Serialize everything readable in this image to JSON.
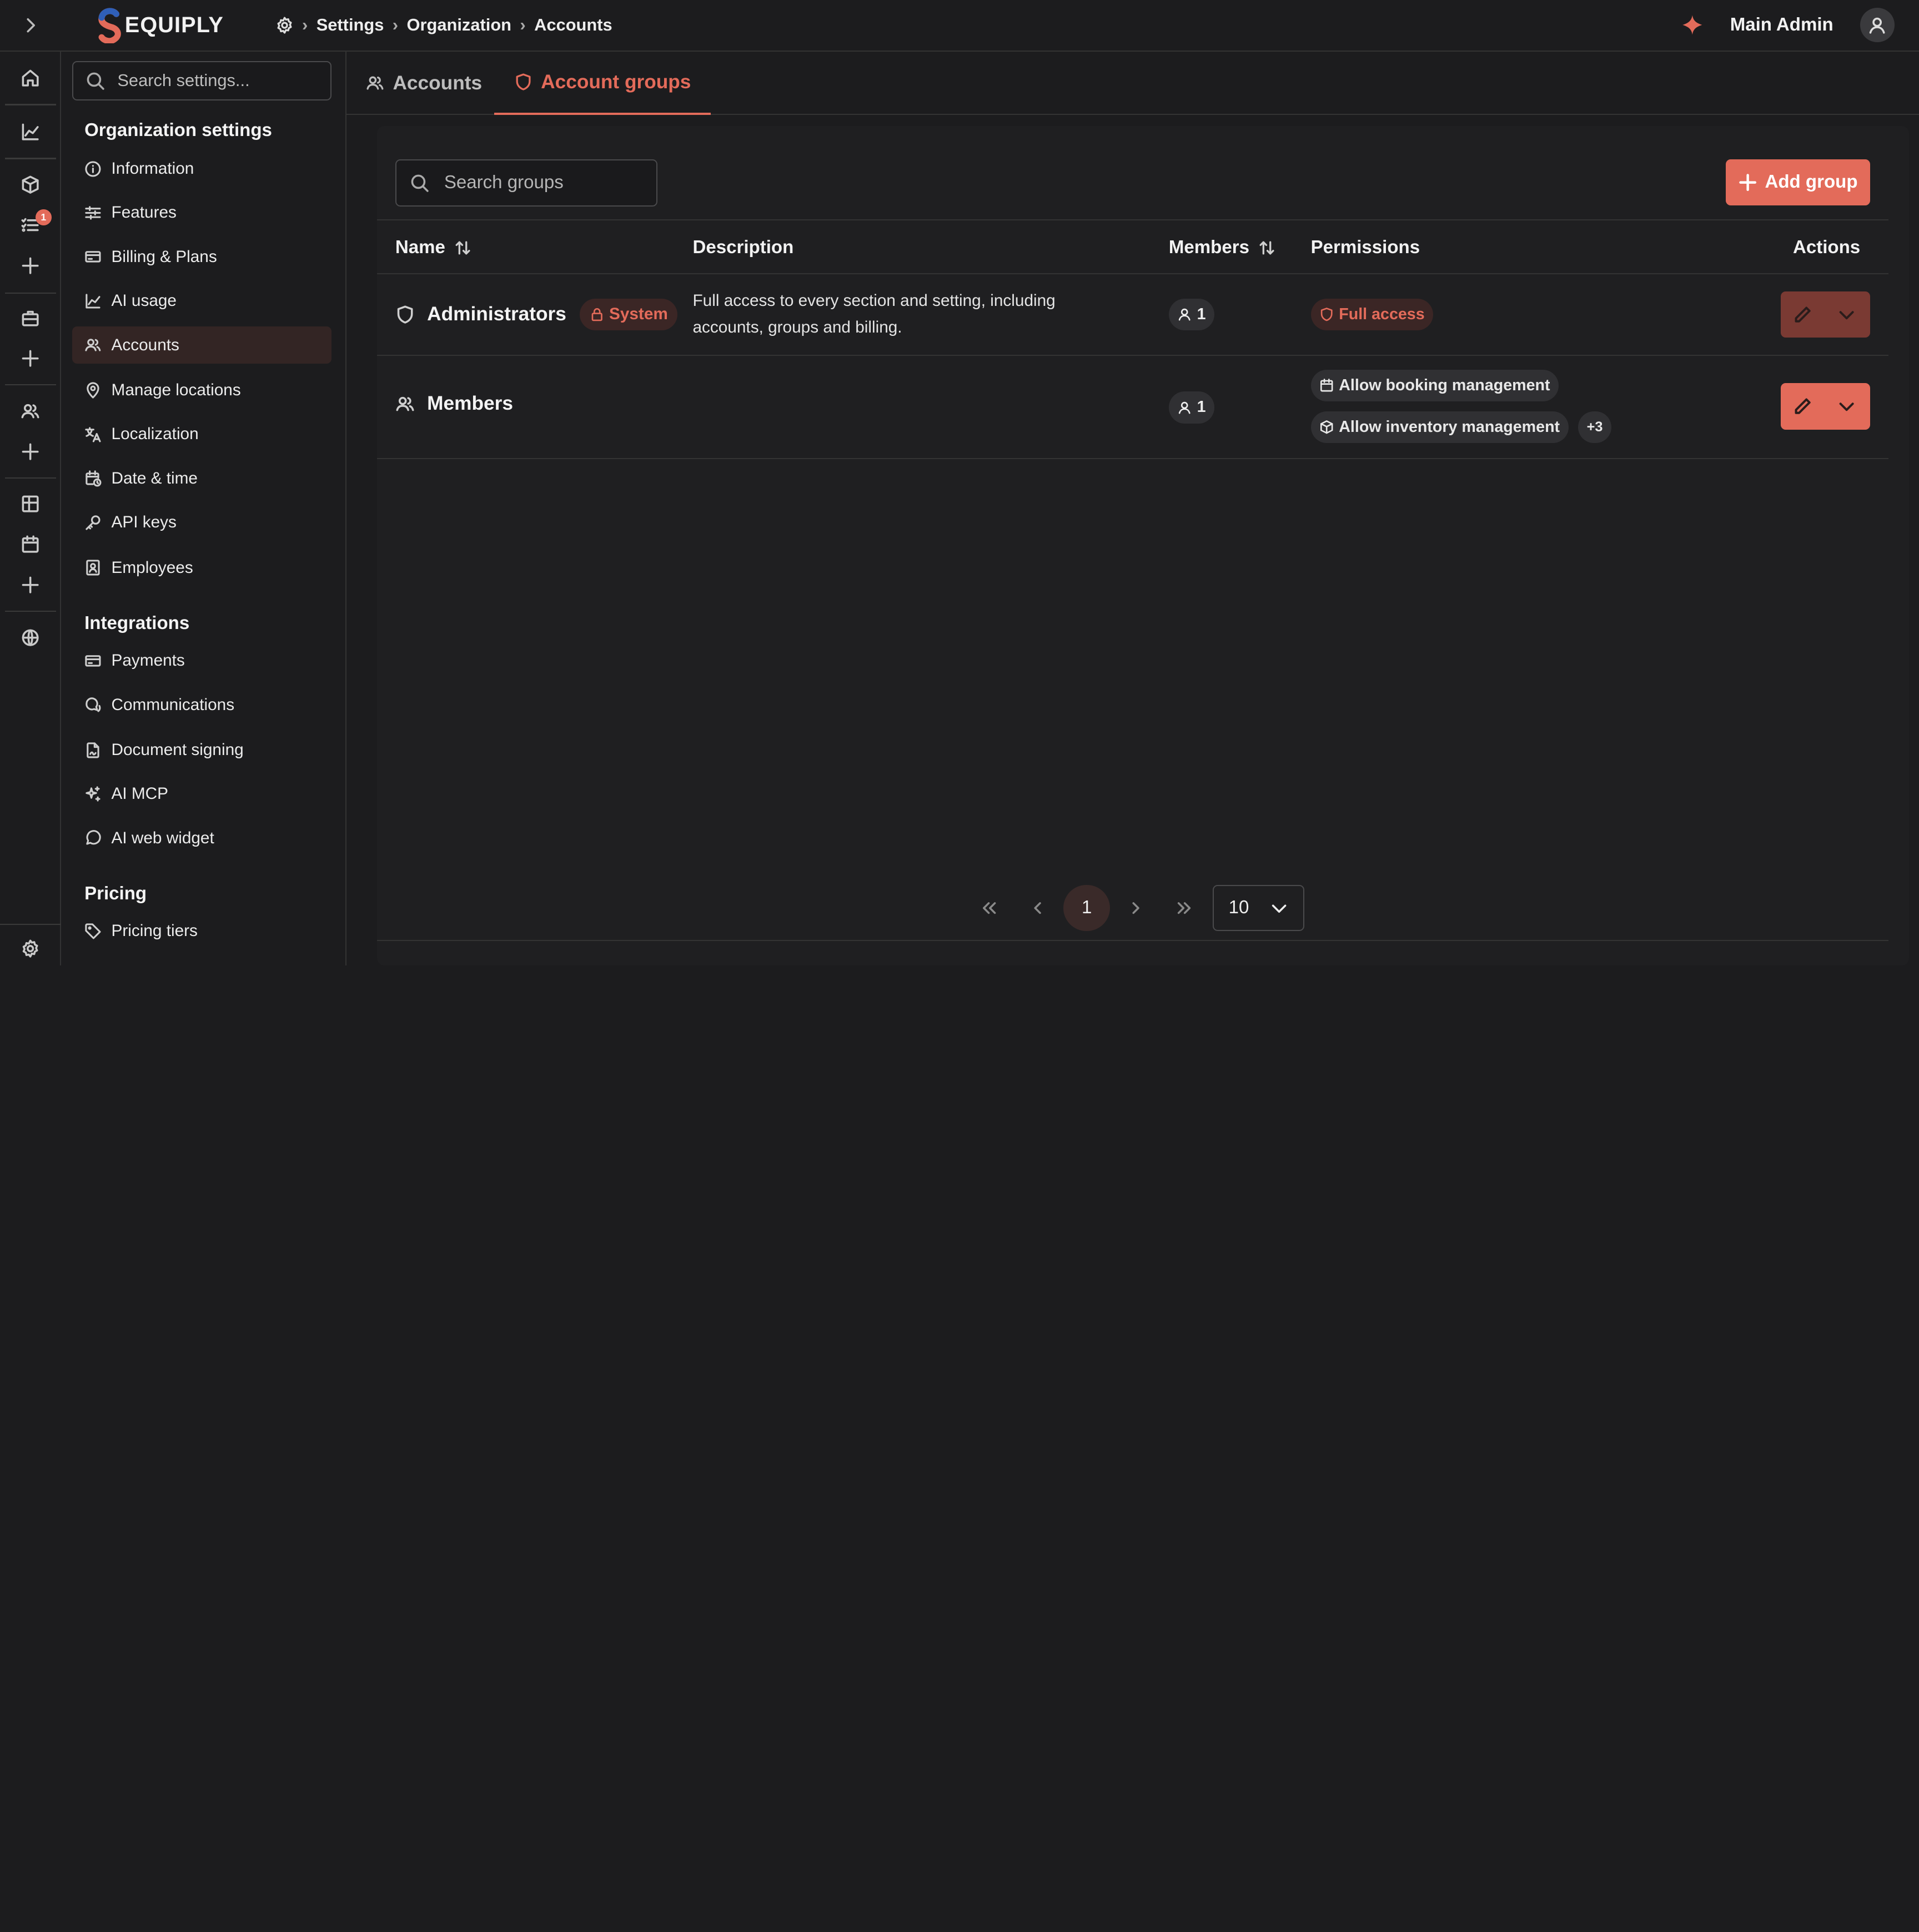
{
  "brand": {
    "name": "EQUIPLY",
    "accent": "#e36b5a"
  },
  "breadcrumb": [
    "Settings",
    "Organization",
    "Accounts"
  ],
  "user": {
    "name": "Main Admin"
  },
  "rail": {
    "tasks_badge": "1"
  },
  "sidebar": {
    "search_placeholder": "Search settings...",
    "sections": [
      {
        "title": "Organization settings",
        "items": [
          {
            "label": "Information",
            "icon": "info-icon"
          },
          {
            "label": "Features",
            "icon": "sliders-icon"
          },
          {
            "label": "Billing & Plans",
            "icon": "credit-card-icon"
          },
          {
            "label": "AI usage",
            "icon": "trend-icon"
          },
          {
            "label": "Accounts",
            "icon": "users-icon",
            "active": true
          },
          {
            "label": "Manage locations",
            "icon": "map-pin-icon"
          },
          {
            "label": "Localization",
            "icon": "translate-icon"
          },
          {
            "label": "Date & time",
            "icon": "calendar-clock-icon"
          },
          {
            "label": "API keys",
            "icon": "key-icon"
          },
          {
            "label": "Employees",
            "icon": "contact-icon"
          }
        ]
      },
      {
        "title": "Integrations",
        "items": [
          {
            "label": "Payments",
            "icon": "credit-card-icon"
          },
          {
            "label": "Communications",
            "icon": "chat-icon"
          },
          {
            "label": "Document signing",
            "icon": "document-sign-icon"
          },
          {
            "label": "AI MCP",
            "icon": "sparkles-icon"
          },
          {
            "label": "AI web widget",
            "icon": "message-circle-icon"
          }
        ]
      },
      {
        "title": "Pricing",
        "items": [
          {
            "label": "Pricing tiers",
            "icon": "tag-icon"
          }
        ]
      }
    ]
  },
  "tabs": [
    {
      "label": "Accounts",
      "icon": "users-icon",
      "active": false
    },
    {
      "label": "Account groups",
      "icon": "shield-icon",
      "active": true
    }
  ],
  "groups_search_placeholder": "Search groups",
  "add_group_label": "Add group",
  "table": {
    "headers": {
      "name": "Name",
      "description": "Description",
      "members": "Members",
      "permissions": "Permissions",
      "actions": "Actions"
    },
    "rows": [
      {
        "name": "Administrators",
        "badge": "System",
        "description": "Full access to every section and setting, including accounts, groups and billing.",
        "members": "1",
        "permissions": [
          "Full access"
        ]
      },
      {
        "name": "Members",
        "description": "",
        "members": "1",
        "permissions": [
          "Allow booking management",
          "Allow inventory management"
        ],
        "more": "+3"
      }
    ]
  },
  "pagination": {
    "current": "1",
    "per_page": "10"
  }
}
